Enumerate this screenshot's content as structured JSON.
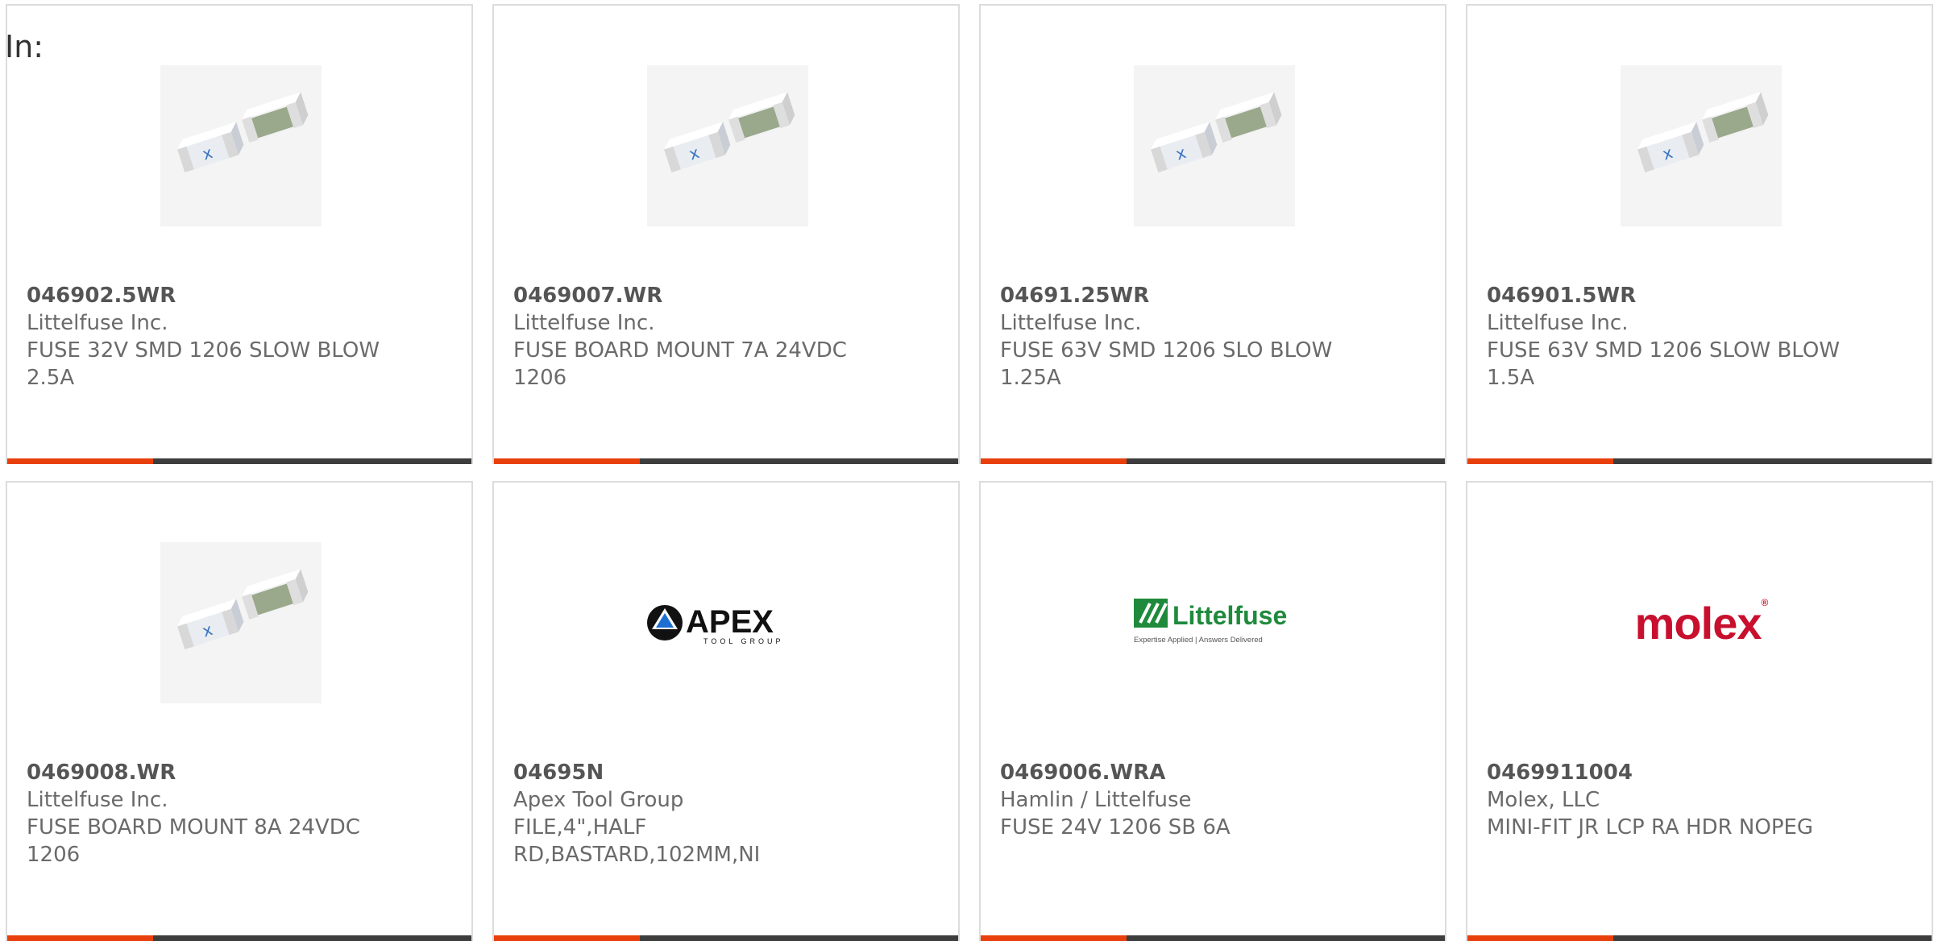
{
  "filter_label": "In:",
  "accent_color": "#e8400c",
  "bar_color": "#3d3d3d",
  "products": [
    {
      "part_number": "046902.5WR",
      "manufacturer": "Littelfuse Inc.",
      "description": "FUSE 32V SMD 1206 SLOW BLOW 2.5A",
      "image": "smd-fuse-photo"
    },
    {
      "part_number": "0469007.WR",
      "manufacturer": "Littelfuse Inc.",
      "description": "FUSE BOARD MOUNT 7A 24VDC 1206",
      "image": "smd-fuse-photo"
    },
    {
      "part_number": "04691.25WR",
      "manufacturer": "Littelfuse Inc.",
      "description": "FUSE 63V SMD 1206 SLO BLOW 1.25A",
      "image": "smd-fuse-photo"
    },
    {
      "part_number": "046901.5WR",
      "manufacturer": "Littelfuse Inc.",
      "description": "FUSE 63V SMD 1206 SLOW BLOW 1.5A",
      "image": "smd-fuse-photo"
    },
    {
      "part_number": "0469008.WR",
      "manufacturer": "Littelfuse Inc.",
      "description": "FUSE BOARD MOUNT 8A 24VDC 1206",
      "image": "smd-fuse-photo"
    },
    {
      "part_number": "04695N",
      "manufacturer": "Apex Tool Group",
      "description": "FILE,4\",HALF RD,BASTARD,102MM,NI",
      "image": "apex-logo",
      "logo_text": "APEX",
      "logo_subtext": "TOOL GROUP"
    },
    {
      "part_number": "0469006.WRA",
      "manufacturer": "Hamlin / Littelfuse",
      "description": "FUSE 24V 1206 SB 6A",
      "image": "littelfuse-logo",
      "logo_text": "Littelfuse",
      "logo_subtext": "Expertise Applied | Answers Delivered"
    },
    {
      "part_number": "0469911004",
      "manufacturer": "Molex, LLC",
      "description": "MINI-FIT JR LCP RA HDR NOPEG",
      "image": "molex-logo",
      "logo_text": "molex"
    }
  ]
}
